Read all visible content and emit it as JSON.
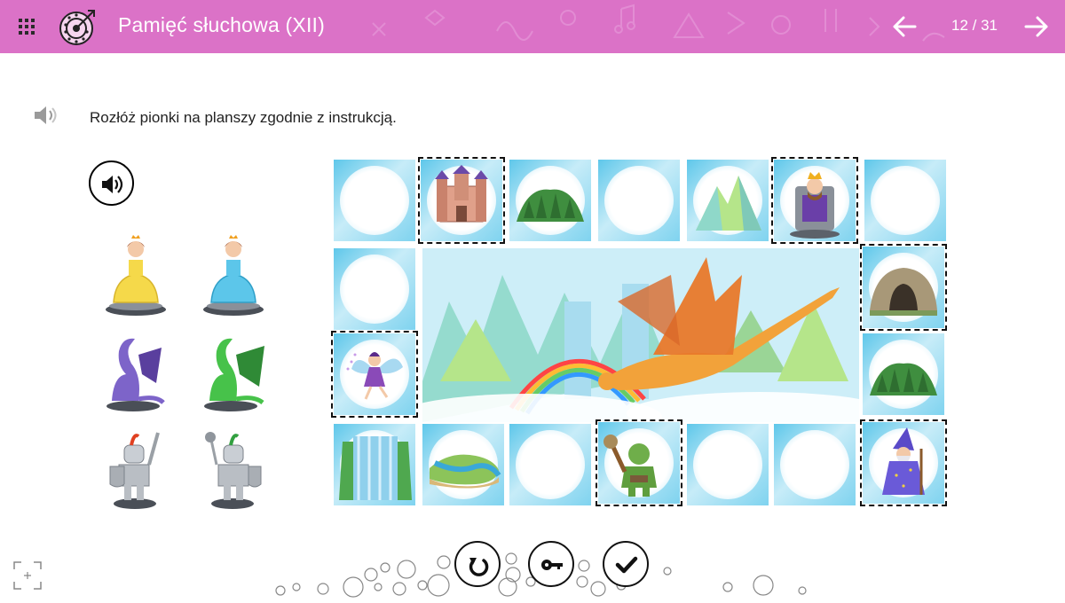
{
  "header": {
    "title": "Pamięć słuchowa (XII)",
    "page_counter": "12 / 31",
    "color": "#db72c7"
  },
  "task": {
    "instruction": "Rozłóż pionki na planszy zgodnie z instrukcją."
  },
  "pawns": [
    {
      "name": "princess-yellow",
      "color": "#f5d94a"
    },
    {
      "name": "princess-blue",
      "color": "#5cc6ea"
    },
    {
      "name": "dragon-purple",
      "color": "#7d64c9"
    },
    {
      "name": "dragon-green",
      "color": "#47c24a"
    },
    {
      "name": "knight-sword",
      "color": "#b9bec4"
    },
    {
      "name": "knight-mace",
      "color": "#b9bec4"
    }
  ],
  "board": {
    "cells": [
      {
        "content": "empty",
        "selected": false
      },
      {
        "content": "castle",
        "selected": true
      },
      {
        "content": "forest",
        "selected": false
      },
      {
        "content": "empty",
        "selected": false
      },
      {
        "content": "mountain",
        "selected": false
      },
      {
        "content": "king",
        "selected": true
      },
      {
        "content": "empty",
        "selected": false
      },
      {
        "content": "empty",
        "selected": false
      },
      {
        "content": "cave",
        "selected": true
      },
      {
        "content": "fairy",
        "selected": true
      },
      {
        "content": "forest",
        "selected": false
      },
      {
        "content": "waterfall",
        "selected": false
      },
      {
        "content": "river",
        "selected": false
      },
      {
        "content": "empty",
        "selected": false
      },
      {
        "content": "troll",
        "selected": true
      },
      {
        "content": "empty",
        "selected": false
      },
      {
        "content": "empty",
        "selected": false
      },
      {
        "content": "wizard",
        "selected": true
      }
    ],
    "center_image": "dragon-landscape"
  },
  "controls": {
    "icons": [
      "play-audio-icon",
      "retry-icon",
      "key-icon",
      "check-icon",
      "fullscreen-icon"
    ]
  }
}
